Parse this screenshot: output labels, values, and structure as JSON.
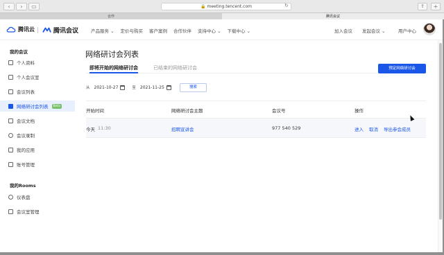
{
  "browser": {
    "url": "meeting.tencent.com",
    "tabs": [
      "合作",
      "腾讯会议"
    ],
    "back": "‹",
    "forward": "›",
    "sidebar": "▭",
    "reload": "↻",
    "share": "⇪",
    "new_tab": "+"
  },
  "header": {
    "brand_cloud": "腾讯云",
    "brand_meeting": "腾讯会议",
    "nav": [
      "产品服务 ⌄",
      "定价与购买",
      "客户案例",
      "合作伙伴",
      "支持中心 ⌄",
      "下载中心 ⌄"
    ],
    "join": "加入会议",
    "schedule": "发起会议 ⌄",
    "user_center": "用户中心"
  },
  "sidebar": {
    "section1": "我的会议",
    "items": [
      {
        "label": "个人资料",
        "icon": "person-icon"
      },
      {
        "label": "个人会议室",
        "icon": "room-icon"
      },
      {
        "label": "会议列表",
        "icon": "list-icon"
      },
      {
        "label": "网络研讨会列表",
        "icon": "webinar-icon",
        "badge": "Beta",
        "active": true
      },
      {
        "label": "会议文档",
        "icon": "document-icon"
      },
      {
        "label": "会议录制",
        "icon": "record-icon"
      },
      {
        "label": "我的应用",
        "icon": "app-icon"
      },
      {
        "label": "账号管理",
        "icon": "account-icon"
      }
    ],
    "section2": "我的Rooms",
    "items2": [
      {
        "label": "仪表盘",
        "icon": "dashboard-icon"
      },
      {
        "label": "会议室管理",
        "icon": "room-manage-icon"
      }
    ]
  },
  "main": {
    "title": "网络研讨会列表",
    "tabs": [
      "即将开始的网络研讨会",
      "已结束的网络研讨会"
    ],
    "create_button": "预定网络研讨会",
    "filter": {
      "from_label": "从",
      "from_date": "2021-10-27",
      "to_label": "至",
      "to_date": "2021-11-25",
      "search": "搜索"
    },
    "table": {
      "headers": [
        "开始时间",
        "网络研讨会主题",
        "会议号",
        "操作"
      ],
      "rows": [
        {
          "day": "今天",
          "time": "11:30",
          "topic": "招聘宣讲会",
          "id": "977 540 529",
          "actions": [
            "进入",
            "取消",
            "导出参会成员"
          ]
        }
      ]
    }
  },
  "colors": {
    "accent": "#1a57e8",
    "active_bg": "#e8efff",
    "row_bg": "#f5f7fb",
    "badge": "#7ac06a"
  }
}
